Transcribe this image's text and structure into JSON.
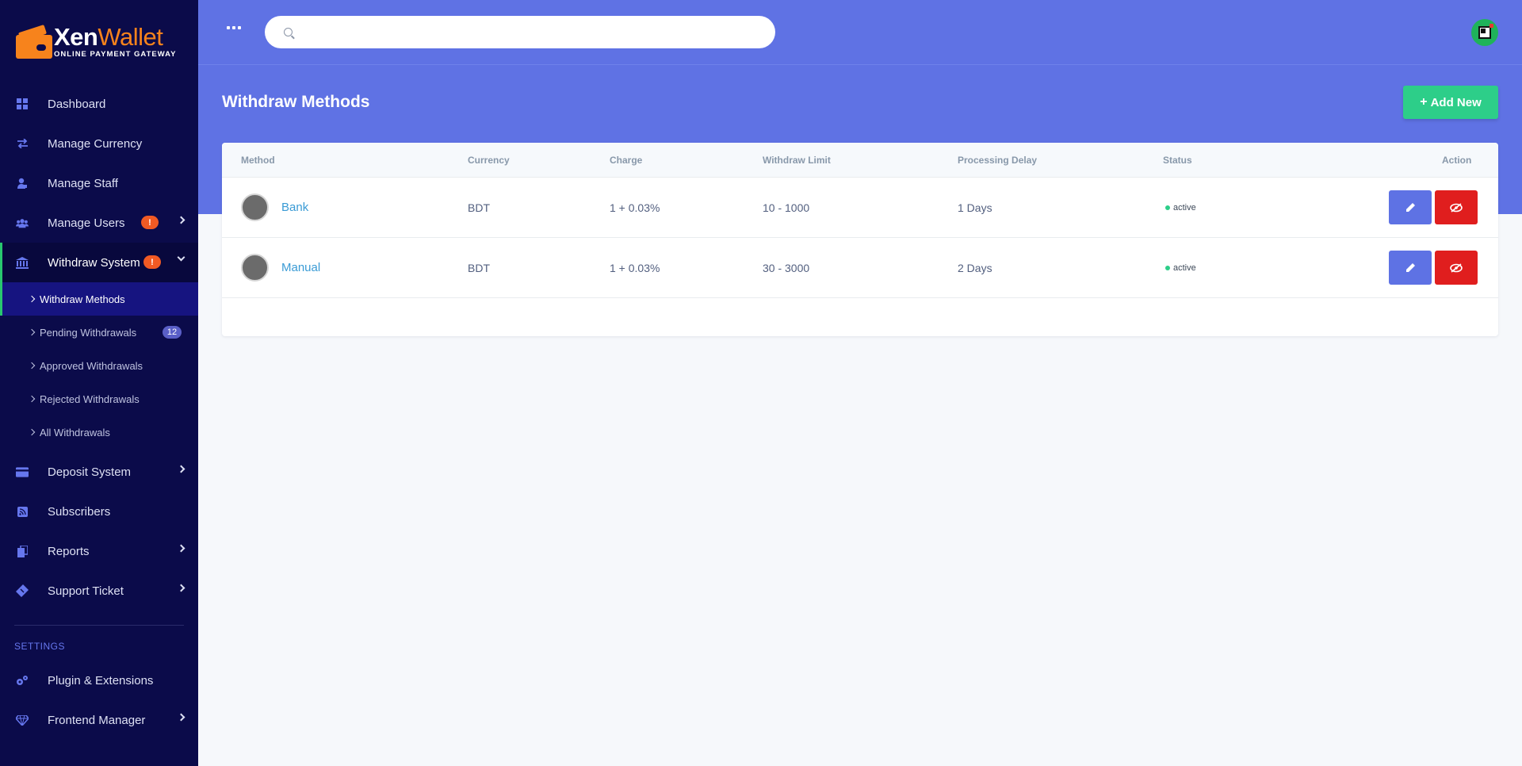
{
  "brand": {
    "name_part1": "Xen",
    "name_part2": "Wallet",
    "tagline": "ONLINE PAYMENT GATEWAY"
  },
  "sidebar": {
    "items": [
      {
        "label": "Dashboard",
        "icon": "grid-icon"
      },
      {
        "label": "Manage Currency",
        "icon": "exchange-icon"
      },
      {
        "label": "Manage Staff",
        "icon": "user-lock-icon"
      },
      {
        "label": "Manage Users",
        "icon": "users-icon",
        "badge": "!"
      },
      {
        "label": "Withdraw System",
        "icon": "bank-icon",
        "badge": "!"
      }
    ],
    "withdraw_sub": [
      {
        "label": "Withdraw Methods"
      },
      {
        "label": "Pending Withdrawals",
        "count": "12"
      },
      {
        "label": "Approved Withdrawals"
      },
      {
        "label": "Rejected Withdrawals"
      },
      {
        "label": "All Withdrawals"
      }
    ],
    "items_after": [
      {
        "label": "Deposit System",
        "icon": "credit-card-icon"
      },
      {
        "label": "Subscribers",
        "icon": "rss-icon"
      },
      {
        "label": "Reports",
        "icon": "copy-icon"
      },
      {
        "label": "Support Ticket",
        "icon": "ticket-icon"
      }
    ],
    "settings_label": "SETTINGS",
    "settings_items": [
      {
        "label": "Plugin & Extensions",
        "icon": "cogs-icon"
      },
      {
        "label": "Frontend Manager",
        "icon": "gem-icon"
      }
    ]
  },
  "search": {
    "placeholder": ""
  },
  "page": {
    "title": "Withdraw Methods",
    "add_button": "Add New"
  },
  "table": {
    "headers": {
      "method": "Method",
      "currency": "Currency",
      "charge": "Charge",
      "limit": "Withdraw Limit",
      "delay": "Processing Delay",
      "status": "Status",
      "action": "Action"
    },
    "rows": [
      {
        "method": "Bank",
        "currency": "BDT",
        "charge": "1 + 0.03%",
        "limit": "10 - 1000",
        "delay": "1 Days",
        "status": "active"
      },
      {
        "method": "Manual",
        "currency": "BDT",
        "charge": "1 + 0.03%",
        "limit": "30 - 3000",
        "delay": "2 Days",
        "status": "active"
      }
    ]
  },
  "colors": {
    "sidebar": "#0b0b4a",
    "accent": "#5f72e4",
    "success": "#2dce89",
    "danger": "#e01e1e",
    "brand_orange": "#f7831c"
  }
}
